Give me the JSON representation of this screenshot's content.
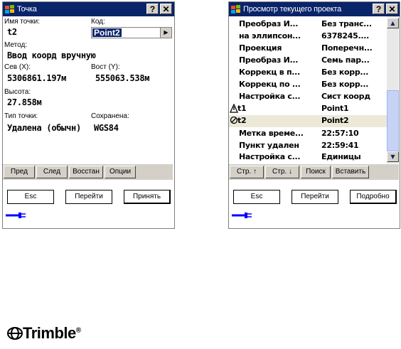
{
  "screen1": {
    "title": "Точка",
    "help": "?",
    "close": "✕",
    "point_name_label": "Имя точки:",
    "point_name_value": "t2",
    "code_label": "Код:",
    "code_value": "Point2",
    "method_label": "Метод:",
    "method_value": "Ввод коорд вручную",
    "north_label": "Сев (X):",
    "north_value": "5306861.197м",
    "east_label": "Вост (Y):",
    "east_value": "555063.538м",
    "elev_label": "Высота:",
    "elev_value": "27.858м",
    "type_label": "Тип точки:",
    "type_value": "Удалена (обычн)",
    "stored_label": "Сохранена:",
    "stored_value": "WGS84",
    "buttons": [
      "Пред",
      "След",
      "Восстан",
      "Опции"
    ],
    "esc": "Esc",
    "goto": "Перейти",
    "accept": "Принять"
  },
  "screen2": {
    "title": "Просмотр текущего проекта",
    "help": "?",
    "close": "✕",
    "rows": [
      {
        "c1": "Преобраз И...",
        "c2": "Без транс..."
      },
      {
        "c1": "на эллипсон...",
        "c2": "6378245...."
      },
      {
        "c1": "Проекция",
        "c2": "Поперечн..."
      },
      {
        "c1": "Преобраз И...",
        "c2": "Семь пар..."
      },
      {
        "c1": "Коррекц в п...",
        "c2": "Без корр..."
      },
      {
        "c1": "Коррекц по ...",
        "c2": "Без корр..."
      },
      {
        "c1": "Настройка с...",
        "c2": "Сист коорд"
      },
      {
        "c1": "t1",
        "c2": "Point1",
        "icon": "warning-triangle-icon"
      },
      {
        "c1": "t2",
        "c2": "Point2",
        "icon": "deleted-circle-icon"
      },
      {
        "c1": "Метка време...",
        "c2": "22:57:10"
      },
      {
        "c1": "Пункт удален",
        "c2": "22:59:41"
      },
      {
        "c1": "Настройка с...",
        "c2": "Единицы"
      }
    ],
    "buttons": [
      "Стр. ↑",
      "Стр. ↓",
      "Поиск",
      "Вставить"
    ],
    "esc": "Esc",
    "goto": "Перейти",
    "details": "Подробно"
  },
  "logo": "Trimble",
  "icons": [
    "windows-flag-icon",
    "connector-plug-icon",
    "scroll-up-icon",
    "scroll-down-icon",
    "dropdown-arrow-icon"
  ],
  "colors": {
    "titlebar": "#0a246a",
    "selected_row": "#ece9d8",
    "accent": "#0000ff"
  }
}
